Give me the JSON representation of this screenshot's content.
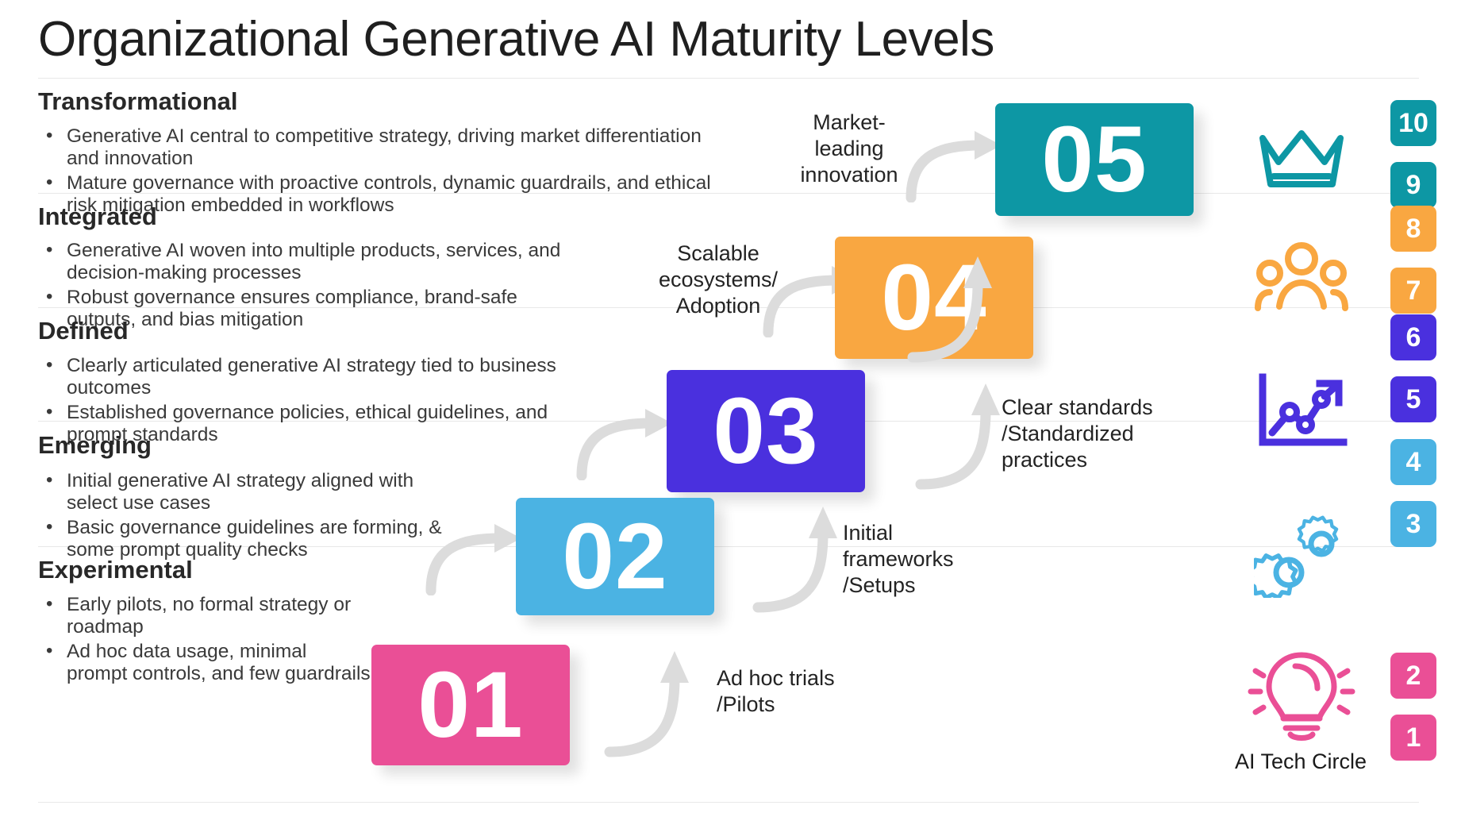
{
  "title": "Organizational Generative AI Maturity Levels",
  "colors": {
    "teal": "#0d97a4",
    "orange": "#f9a741",
    "purple": "#4a30de",
    "blue": "#4bb3e3",
    "pink": "#ea4f96",
    "arrow": "#dcdcdc",
    "text": "#282828"
  },
  "levels": [
    {
      "name": "Transformational",
      "number": "05",
      "color": "#0d97a4",
      "caption": "Market-\nleading\ninnovation",
      "caption_lines": [
        "Market-",
        "leading",
        "innovation"
      ],
      "icon": "crown-icon",
      "badges": [
        "10",
        "9"
      ],
      "bullets": [
        "Generative AI central to competitive strategy, driving market differentiation and innovation",
        "Mature governance with proactive controls, dynamic guardrails, and ethical risk mitigation embedded in workflows"
      ]
    },
    {
      "name": "Integrated",
      "number": "04",
      "color": "#f9a741",
      "caption": "Scalable\necosystems/\nAdoption",
      "caption_lines": [
        "Scalable",
        "ecosystems/",
        "Adoption"
      ],
      "icon": "people-group-icon",
      "badges": [
        "8",
        "7"
      ],
      "bullets": [
        "Generative AI woven into multiple products, services, and decision-making processes",
        "Robust governance ensures compliance, brand-safe outputs, and bias mitigation"
      ]
    },
    {
      "name": "Defined",
      "number": "03",
      "color": "#4a30de",
      "caption": "Clear standards\n/Standardized\npractices",
      "caption_lines": [
        "Clear standards",
        "/Standardized",
        "practices"
      ],
      "icon": "growth-chart-icon",
      "badges": [
        "6",
        "5"
      ],
      "bullets": [
        "Clearly articulated generative AI strategy tied to business outcomes",
        "Established governance policies, ethical guidelines, and prompt standards"
      ]
    },
    {
      "name": "Emerging",
      "number": "02",
      "color": "#4bb3e3",
      "caption": "Initial\nframeworks\n/Setups",
      "caption_lines": [
        "Initial",
        "frameworks",
        "/Setups"
      ],
      "icon": "gears-icon",
      "badges": [
        "4",
        "3"
      ],
      "bullets": [
        "Initial generative AI strategy aligned with select use cases",
        "Basic governance guidelines are forming, & some prompt quality checks"
      ]
    },
    {
      "name": "Experimental",
      "number": "01",
      "color": "#ea4f96",
      "caption": "Ad hoc trials\n/Pilots",
      "caption_lines": [
        "Ad hoc trials",
        "/Pilots"
      ],
      "icon": "lightbulb-icon",
      "badges": [
        "2",
        "1"
      ],
      "bullets": [
        "Early pilots, no formal strategy or roadmap",
        "Ad hoc data usage, minimal prompt controls, and few guardrails"
      ]
    }
  ],
  "footer": {
    "brand_label": "AI Tech Circle"
  }
}
